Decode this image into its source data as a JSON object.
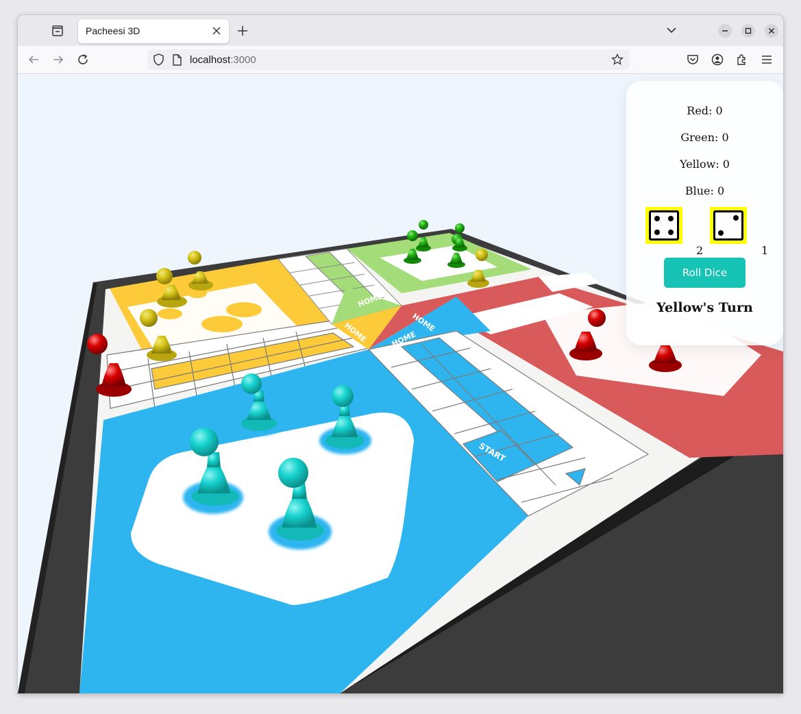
{
  "browser": {
    "tab_title": "Pacheesi 3D",
    "url_host": "localhost",
    "url_port": ":3000"
  },
  "board": {
    "home_label": "HOME",
    "start_label": "START",
    "colors": {
      "yellow": "#fdcb3a",
      "green": "#a3dc78",
      "red": "#d85a5a",
      "blue": "#2eb5f0"
    },
    "pawns": {
      "red_piece": "#d80000",
      "green_piece": "#22b014",
      "yellow_piece": "#d6c41a",
      "blue_piece": "#17d3cf"
    }
  },
  "scores": [
    {
      "label": "Red: 0"
    },
    {
      "label": "Green: 0"
    },
    {
      "label": "Yellow: 0"
    },
    {
      "label": "Blue: 0"
    }
  ],
  "dice": [
    {
      "pips": 4,
      "value": "2"
    },
    {
      "pips": 2,
      "value": "1"
    }
  ],
  "controls": {
    "roll_label": "Roll Dice",
    "turn_label": "Yellow's Turn"
  }
}
